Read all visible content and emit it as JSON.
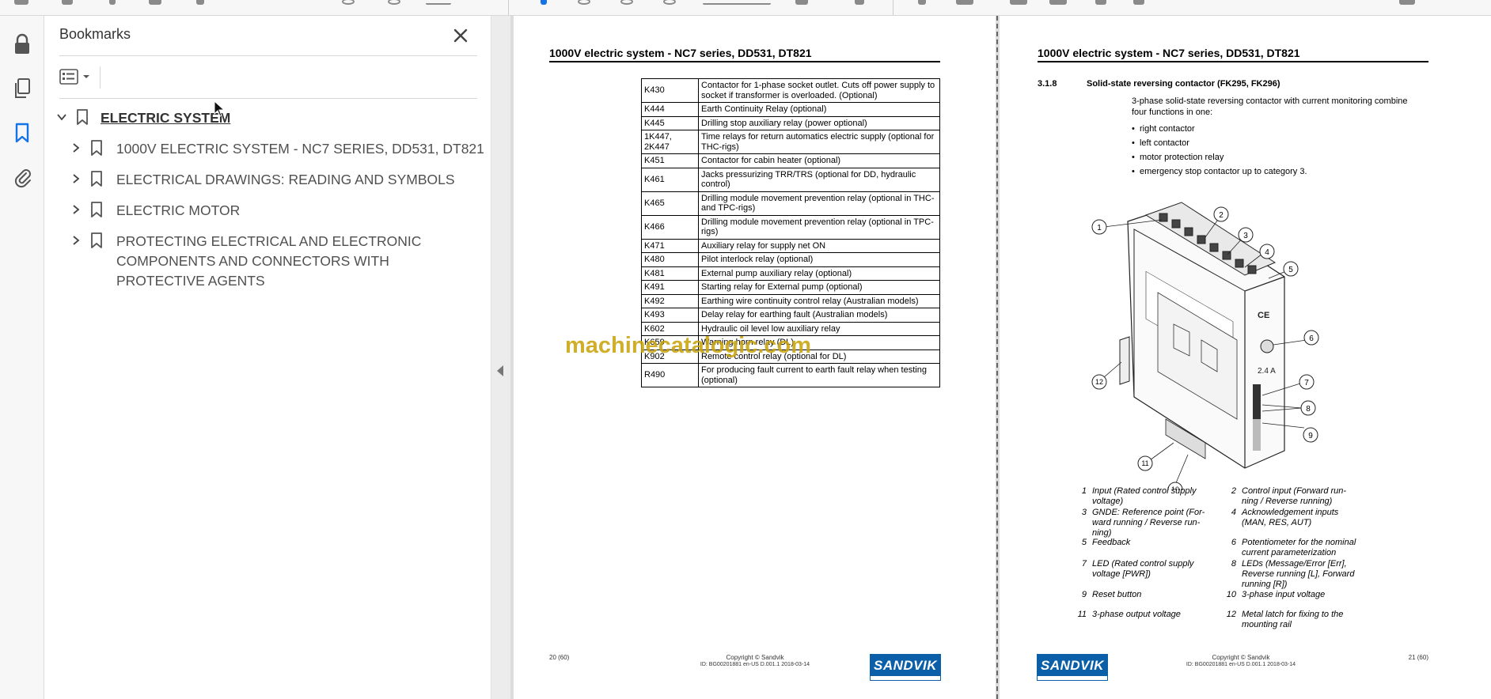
{
  "bookmarks_panel": {
    "title": "Bookmarks",
    "items": [
      {
        "label": "ELECTRIC SYSTEM",
        "level": 0,
        "expanded": true
      },
      {
        "label": "1000V ELECTRIC SYSTEM - NC7 SERIES, DD531, DT821",
        "level": 1,
        "expanded": false
      },
      {
        "label": "ELECTRICAL DRAWINGS: READING AND SYMBOLS",
        "level": 1,
        "expanded": false
      },
      {
        "label": "ELECTRIC MOTOR",
        "level": 1,
        "expanded": false
      },
      {
        "label": "PROTECTING ELECTRICAL AND ELECTRONIC COMPONENTS AND CONNECTORS WITH PROTECTIVE AGENTS",
        "level": 1,
        "expanded": false
      }
    ]
  },
  "left_rail": {
    "icons": [
      "lock-icon",
      "pages-icon",
      "bookmark-icon",
      "attachment-icon"
    ],
    "active": "bookmark-icon"
  },
  "watermark": "machinecatalogic.com",
  "page_left": {
    "header": "1000V electric system - NC7 series, DD531, DT821",
    "relay_table": [
      {
        "code": "K430",
        "desc": "Contactor for 1-phase socket outlet. Cuts off power supply to socket if transformer is overloaded. (Optional)"
      },
      {
        "code": "K444",
        "desc": "Earth Continuity Relay (optional)"
      },
      {
        "code": "K445",
        "desc": "Drilling stop auxiliary relay (power optional)"
      },
      {
        "code": "1K447, 2K447",
        "desc": "Time relays for return automatics electric supply (optional for THC-rigs)"
      },
      {
        "code": "K451",
        "desc": "Contactor for cabin heater (optional)"
      },
      {
        "code": "K461",
        "desc": "Jacks pressurizing TRR/TRS (optional for DD, hydraulic control)"
      },
      {
        "code": "K465",
        "desc": "Drilling module movement prevention relay (optional in THC- and TPC-rigs)"
      },
      {
        "code": "K466",
        "desc": "Drilling module movement prevention relay (optional in TPC-rigs)"
      },
      {
        "code": "K471",
        "desc": "Auxiliary relay for supply net ON"
      },
      {
        "code": "K480",
        "desc": "Pilot interlock relay (optional)"
      },
      {
        "code": "K481",
        "desc": "External pump auxiliary relay (optional)"
      },
      {
        "code": "K491",
        "desc": "Starting relay for External pump (optional)"
      },
      {
        "code": "K492",
        "desc": "Earthing wire continuity control relay (Australian models)"
      },
      {
        "code": "K493",
        "desc": "Delay relay for earthing fault (Australian models)"
      },
      {
        "code": "K602",
        "desc": "Hydraulic oil level low auxiliary relay"
      },
      {
        "code": "K659",
        "desc": "Warning horn relay (DL)"
      },
      {
        "code": "K902",
        "desc": "Remote control relay (optional for DL)"
      },
      {
        "code": "R490",
        "desc": "For producing fault current to earth fault relay when testing (optional)"
      }
    ],
    "page_number": "20 (60)",
    "copyright": "Copyright © Sandvik",
    "doc_id": "ID: BG00201881 en-US D.001.1 2018-03-14",
    "logo": "SANDVIK"
  },
  "page_right": {
    "header": "1000V electric system - NC7 series, DD531, DT821",
    "section_number": "3.1.8",
    "section_title": "Solid-state reversing contactor (FK295, FK296)",
    "intro": "3-phase solid-state reversing contactor with current monitoring combine four functions in one:",
    "bullets": [
      "right contactor",
      "left contactor",
      "motor protection relay",
      "emergency stop contactor up to category 3."
    ],
    "callouts": [
      "1",
      "2",
      "3",
      "4",
      "5",
      "6",
      "7",
      "8",
      "8",
      "9",
      "10",
      "11",
      "12"
    ],
    "figure_labels": [
      "2.4 A"
    ],
    "legend": [
      {
        "n": "1",
        "text": "Input (Rated control supply voltage)"
      },
      {
        "n": "2",
        "text": "Control input (Forward run-ning / Reverse running)"
      },
      {
        "n": "3",
        "text": "GNDE: Reference point (For-ward running / Reverse run-ning)"
      },
      {
        "n": "4",
        "text": "Acknowledgement inputs (MAN, RES, AUT)"
      },
      {
        "n": "5",
        "text": "Feedback"
      },
      {
        "n": "6",
        "text": "Potentiometer for the nominal current parameterization"
      },
      {
        "n": "7",
        "text": "LED (Rated control supply voltage [PWR])"
      },
      {
        "n": "8",
        "text": "LEDs (Message/Error [Err], Reverse running [L], Forward running [R])"
      },
      {
        "n": "9",
        "text": "Reset button"
      },
      {
        "n": "10",
        "text": "3-phase input voltage"
      },
      {
        "n": "11",
        "text": "3-phase output voltage"
      },
      {
        "n": "12",
        "text": "Metal latch for fixing to the mounting rail"
      }
    ],
    "page_number": "21 (60)",
    "copyright": "Copyright © Sandvik",
    "doc_id": "ID: BG00201881 en-US D.001.1 2018-03-14",
    "logo": "SANDVIK"
  },
  "colors": {
    "accent": "#1473e6",
    "brand": "#0a5fa8",
    "watermark": "#c9a40c"
  }
}
